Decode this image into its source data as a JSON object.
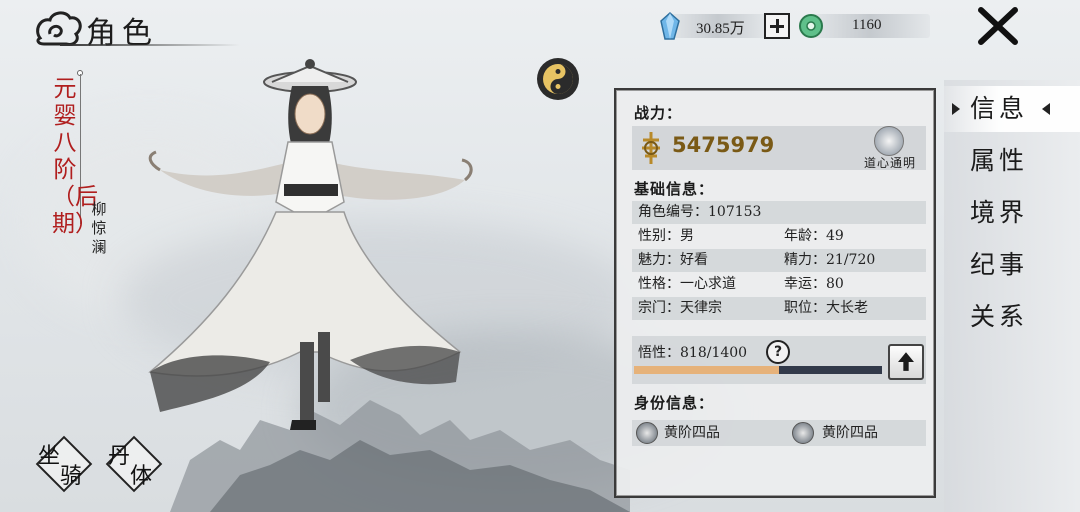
{
  "header": {
    "title": "角色",
    "currency": [
      {
        "name": "spirit-stone",
        "value": "30.85万"
      },
      {
        "name": "jade",
        "value": "1160"
      }
    ]
  },
  "nav": {
    "items": [
      {
        "label": "信息",
        "active": true
      },
      {
        "label": "属性",
        "active": false
      },
      {
        "label": "境界",
        "active": false
      },
      {
        "label": "纪事",
        "active": false
      },
      {
        "label": "关系",
        "active": false
      }
    ]
  },
  "character": {
    "realm": "元婴八阶（后期）",
    "name": "柳惊澜"
  },
  "buttons": {
    "mount": [
      "坐",
      "骑"
    ],
    "body": [
      "丹",
      "体"
    ]
  },
  "panel": {
    "power_title": "战力：",
    "power_value": "5475979",
    "daoxin_label": "道心通明",
    "basic_title": "基础信息：",
    "basic": {
      "id": "角色编号：107153",
      "gender": "性别：男",
      "age": "年龄：49",
      "charm": "魅力：好看",
      "energy": "精力：21/720",
      "personality": "性格：一心求道",
      "luck": "幸运：80",
      "sect": "宗门：天律宗",
      "position": "职位：大长老"
    },
    "insight_label": "悟性：",
    "insight_value": "818/1400",
    "insight_current": 818,
    "insight_max": 1400,
    "help_label": "?",
    "identity_title": "身份信息：",
    "identity": [
      "黄阶四品",
      "黄阶四品"
    ]
  },
  "colors": {
    "realm": "#b01e1e",
    "power": "#7a5a16",
    "insight_fill": "#e6b27a",
    "insight_track": "#323a4a"
  }
}
